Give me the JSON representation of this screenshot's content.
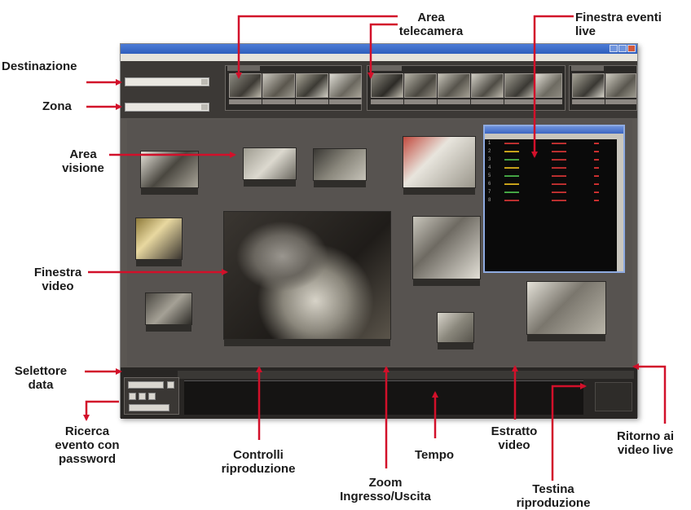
{
  "annotations": {
    "area_telecamera": "Area\ntelecamera",
    "finestra_eventi_live": "Finestra eventi\nlive",
    "destinazione": "Destinazione",
    "zona": "Zona",
    "area_visione": "Area\nvisione",
    "finestra_video": "Finestra\nvideo",
    "selettore_data": "Selettore\ndata",
    "ricerca_evento": "Ricerca\nevento con\npassword",
    "controlli_riproduzione": "Controlli\nriproduzione",
    "tempo": "Tempo",
    "estratto_video": "Estratto\nvideo",
    "ritorno_video_live": "Ritorno ai\nvideo live",
    "zoom": "Zoom\nIngresso/Uscita",
    "testina_riproduzione": "Testina\nriproduzione"
  },
  "colors": {
    "arrow": "#d2102a",
    "window_bg": "#5a5652",
    "titlebar": "#2f5fbd"
  }
}
